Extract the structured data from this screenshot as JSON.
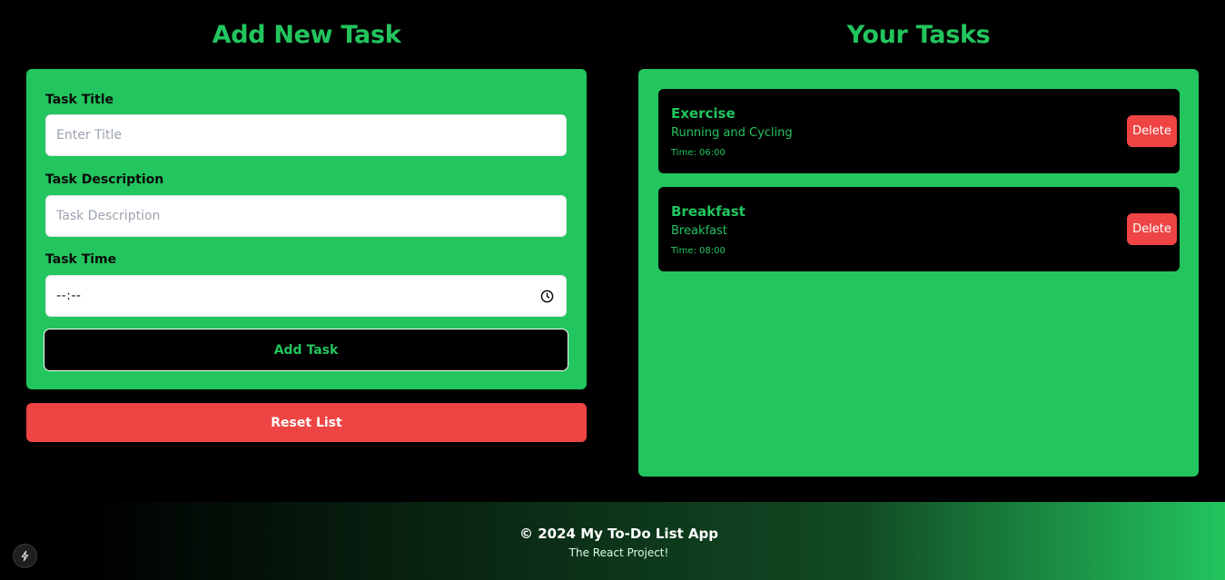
{
  "add_section": {
    "heading": "Add New Task",
    "title_field": {
      "label": "Task Title",
      "placeholder": "Enter Title"
    },
    "description_field": {
      "label": "Task Description",
      "placeholder": "Task Description"
    },
    "time_field": {
      "label": "Task Time",
      "value": "--:--"
    },
    "add_button": "Add Task",
    "reset_button": "Reset List"
  },
  "tasks_section": {
    "heading": "Your Tasks",
    "tasks": [
      {
        "title": "Exercise",
        "description": "Running and Cycling",
        "time": "Time: 06:00",
        "delete_label": "Delete"
      },
      {
        "title": "Breakfast",
        "description": "Breakfast",
        "time": "Time: 08:00",
        "delete_label": "Delete"
      }
    ]
  },
  "footer": {
    "title": "© 2024 My To-Do List App",
    "subtitle": "The React Project!"
  },
  "colors": {
    "background": "#000000",
    "accent_green": "#22c55e",
    "danger_red": "#ef4444"
  },
  "icons": {
    "time_picker": "clock-icon",
    "dev_badge": "lightning-icon"
  }
}
